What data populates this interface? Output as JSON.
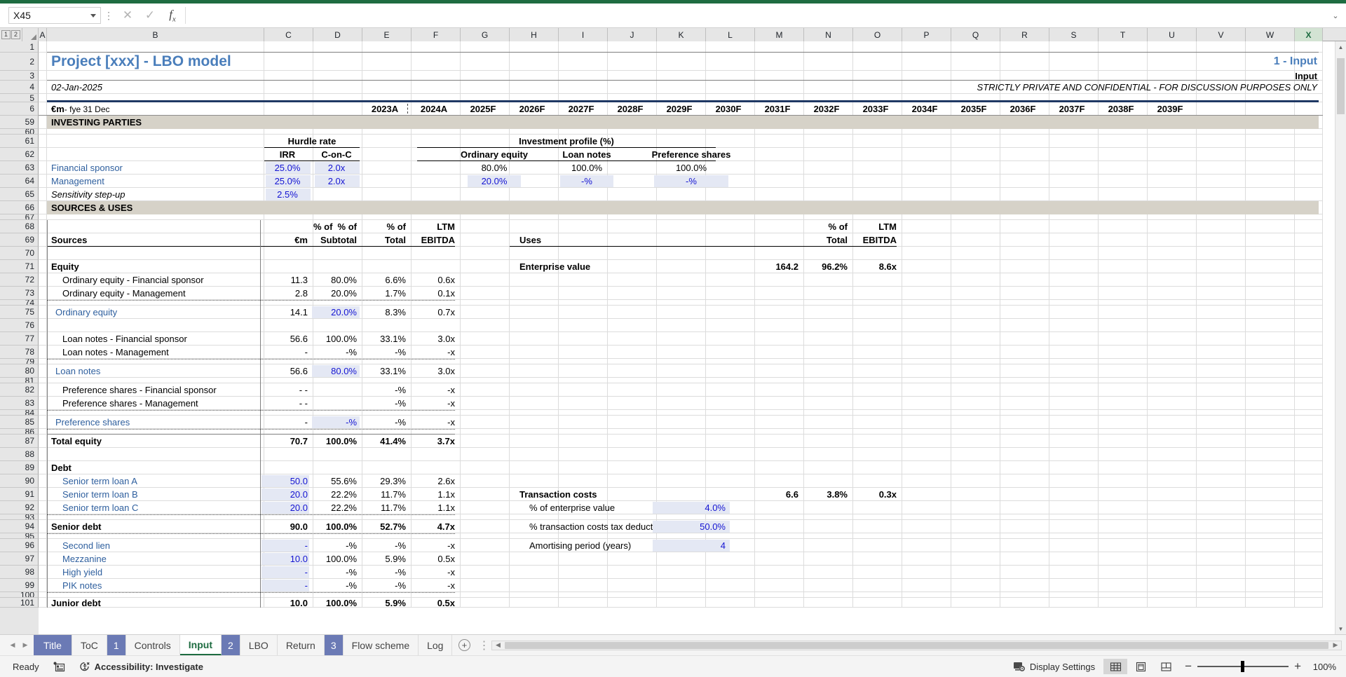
{
  "app": {
    "namebox_value": "X45",
    "formula_value": "",
    "formula_placeholder": ""
  },
  "columns": [
    "A",
    "B",
    "C",
    "D",
    "E",
    "F",
    "G",
    "H",
    "I",
    "J",
    "K",
    "L",
    "M",
    "N",
    "O",
    "P",
    "Q",
    "R",
    "S",
    "T",
    "U",
    "V",
    "W",
    "X"
  ],
  "selected_column": "X",
  "outline_levels": [
    "1",
    "2"
  ],
  "rows": [
    "1",
    "2",
    "3",
    "4",
    "5",
    "6",
    "59",
    "60",
    "61",
    "62",
    "63",
    "64",
    "65",
    "66",
    "67",
    "68",
    "69",
    "70",
    "71",
    "72",
    "73",
    "74",
    "75",
    "76",
    "77",
    "78",
    "79",
    "80",
    "81",
    "82",
    "83",
    "84",
    "85",
    "86",
    "87",
    "88",
    "89",
    "90",
    "91",
    "92",
    "93",
    "94",
    "95",
    "96",
    "97",
    "98",
    "99",
    "100",
    "101"
  ],
  "header": {
    "title": "Project [xxx]  - LBO model",
    "date": "02-Jan-2025",
    "sheet_code": "1 - Input",
    "sheet_name": "Input",
    "confidential": "STRICTLY PRIVATE AND CONFIDENTIAL - FOR DISCUSSION PURPOSES ONLY",
    "units": "€m",
    "units_suffix": " - fye 31 Dec",
    "years": [
      "2023A",
      "2024A",
      "2025F",
      "2026F",
      "2027F",
      "2028F",
      "2029F",
      "2030F",
      "2031F",
      "2032F",
      "2033F",
      "2034F",
      "2035F",
      "2036F",
      "2037F",
      "2038F",
      "2039F"
    ]
  },
  "investing_parties": {
    "section_title": "INVESTING PARTIES",
    "group_headers": {
      "hurdle_rate": "Hurdle rate",
      "investment_profile": "Investment profile (%)"
    },
    "col_headers": {
      "irr": "IRR",
      "conc": "C-on-C",
      "ordinary_equity": "Ordinary equity",
      "loan_notes": "Loan notes",
      "preference_shares": "Preference shares"
    },
    "rows": [
      {
        "label": "Financial sponsor",
        "irr": "25.0%",
        "conc": "2.0x",
        "ordinary_equity": "80.0%",
        "loan_notes": "100.0%",
        "preference_shares": "100.0%"
      },
      {
        "label": "Management",
        "irr": "25.0%",
        "conc": "2.0x",
        "ordinary_equity": "20.0%",
        "loan_notes": "-%",
        "preference_shares": "-%"
      }
    ],
    "sensitivity": {
      "label": "Sensitivity step-up",
      "value": "2.5%"
    }
  },
  "sources_uses": {
    "section_title": "SOURCES & USES",
    "sources": {
      "header": "Sources",
      "col_headers": {
        "amount": "€m",
        "pct_subtotal_l1": "% of",
        "pct_subtotal_l2": "Subtotal",
        "pct_total_l1": "% of",
        "pct_total_l2": "Total",
        "ltm_l1": "LTM",
        "ltm_l2": "EBITDA"
      },
      "rows": [
        {
          "row": 71,
          "label": "Equity",
          "style": "bold",
          "amount": "",
          "pct_subtotal": "",
          "pct_total": "",
          "ltm": ""
        },
        {
          "row": 72,
          "label": "Ordinary equity - Financial sponsor",
          "style": "indent",
          "amount": "11.3",
          "pct_subtotal": "80.0%",
          "pct_total": "6.6%",
          "ltm": "0.6x"
        },
        {
          "row": 73,
          "label": "Ordinary equity - Management",
          "style": "indent",
          "amount": "2.8",
          "pct_subtotal": "20.0%",
          "pct_total": "1.7%",
          "ltm": "0.1x"
        },
        {
          "row": 75,
          "label": "Ordinary equity",
          "style": "subtotal-blue",
          "amount": "14.1",
          "pct_subtotal": "20.0%",
          "pct_subtotal_input": true,
          "pct_total": "8.3%",
          "ltm": "0.7x"
        },
        {
          "row": 77,
          "label": "Loan notes - Financial sponsor",
          "style": "indent",
          "amount": "56.6",
          "pct_subtotal": "100.0%",
          "pct_total": "33.1%",
          "ltm": "3.0x"
        },
        {
          "row": 78,
          "label": "Loan notes - Management",
          "style": "indent",
          "amount": "-",
          "pct_subtotal": "-%",
          "pct_total": "-%",
          "ltm": "-x"
        },
        {
          "row": 80,
          "label": "Loan notes",
          "style": "subtotal-blue",
          "amount": "56.6",
          "pct_subtotal": "80.0%",
          "pct_subtotal_input": true,
          "pct_total": "33.1%",
          "ltm": "3.0x"
        },
        {
          "row": 82,
          "label": "Preference shares - Financial sponsor",
          "style": "indent",
          "amount": "- -",
          "pct_subtotal": "",
          "pct_total": "-%",
          "ltm": "-x"
        },
        {
          "row": 83,
          "label": "Preference shares - Management",
          "style": "indent",
          "amount": "- -",
          "pct_subtotal": "",
          "pct_total": "-%",
          "ltm": "-x"
        },
        {
          "row": 85,
          "label": "Preference shares",
          "style": "subtotal-blue",
          "amount": "-",
          "pct_subtotal": "-%",
          "pct_subtotal_input": true,
          "pct_total": "-%",
          "ltm": "-x"
        },
        {
          "row": 87,
          "label": "Total equity",
          "style": "total",
          "amount": "70.7",
          "pct_subtotal": "100.0%",
          "pct_total": "41.4%",
          "ltm": "3.7x"
        },
        {
          "row": 89,
          "label": "Debt",
          "style": "bold",
          "amount": "",
          "pct_subtotal": "",
          "pct_total": "",
          "ltm": ""
        },
        {
          "row": 90,
          "label": "Senior term loan A",
          "style": "indent-blue",
          "amount": "50.0",
          "amount_input": true,
          "pct_subtotal": "55.6%",
          "pct_total": "29.3%",
          "ltm": "2.6x"
        },
        {
          "row": 91,
          "label": "Senior term loan B",
          "style": "indent-blue",
          "amount": "20.0",
          "amount_input": true,
          "pct_subtotal": "22.2%",
          "pct_total": "11.7%",
          "ltm": "1.1x"
        },
        {
          "row": 92,
          "label": "Senior term loan C",
          "style": "indent-blue",
          "amount": "20.0",
          "amount_input": true,
          "pct_subtotal": "22.2%",
          "pct_total": "11.7%",
          "ltm": "1.1x"
        },
        {
          "row": 94,
          "label": "Senior debt",
          "style": "total",
          "amount": "90.0",
          "pct_subtotal": "100.0%",
          "pct_total": "52.7%",
          "ltm": "4.7x"
        },
        {
          "row": 96,
          "label": "Second lien",
          "style": "indent-blue",
          "amount": "-",
          "amount_input": true,
          "pct_subtotal": "-%",
          "pct_total": "-%",
          "ltm": "-x"
        },
        {
          "row": 97,
          "label": "Mezzanine",
          "style": "indent-blue",
          "amount": "10.0",
          "amount_input": true,
          "pct_subtotal": "100.0%",
          "pct_total": "5.9%",
          "ltm": "0.5x"
        },
        {
          "row": 98,
          "label": "High yield",
          "style": "indent-blue",
          "amount": "-",
          "amount_input": true,
          "pct_subtotal": "-%",
          "pct_total": "-%",
          "ltm": "-x"
        },
        {
          "row": 99,
          "label": "PIK notes",
          "style": "indent-blue",
          "amount": "-",
          "amount_input": true,
          "pct_subtotal": "-%",
          "pct_total": "-%",
          "ltm": "-x"
        },
        {
          "row": 101,
          "label": "Junior debt",
          "style": "total",
          "amount": "10.0",
          "pct_subtotal": "100.0%",
          "pct_total": "5.9%",
          "ltm": "0.5x"
        }
      ]
    },
    "uses": {
      "header": "Uses",
      "col_headers": {
        "pct_total_l1": "% of",
        "pct_total_l2": "Total",
        "ltm_l1": "LTM",
        "ltm_l2": "EBITDA"
      },
      "rows": [
        {
          "row": 71,
          "label": "Enterprise value",
          "style": "bold",
          "amount": "164.2",
          "pct_total": "96.2%",
          "ltm": "8.6x"
        },
        {
          "row": 91,
          "label": "Transaction costs",
          "style": "bold",
          "amount": "6.6",
          "pct_total": "3.8%",
          "ltm": "0.3x"
        },
        {
          "row": 92,
          "label": "% of enterprise value",
          "style": "indent",
          "input_value": "4.0%"
        },
        {
          "row": 94,
          "label": "% transaction costs tax deductible",
          "style": "indent",
          "input_value": "50.0%"
        },
        {
          "row": 96,
          "label": "Amortising period (years)",
          "style": "indent",
          "input_value": "4"
        }
      ]
    }
  },
  "sheet_tabs": [
    {
      "label": "Title",
      "type": "color"
    },
    {
      "label": "ToC",
      "type": "normal"
    },
    {
      "label": "1",
      "type": "color"
    },
    {
      "label": "Controls",
      "type": "normal"
    },
    {
      "label": "Input",
      "type": "active"
    },
    {
      "label": "2",
      "type": "color"
    },
    {
      "label": "LBO",
      "type": "normal"
    },
    {
      "label": "Return",
      "type": "normal"
    },
    {
      "label": "3",
      "type": "color"
    },
    {
      "label": "Flow scheme",
      "type": "normal"
    },
    {
      "label": "Log",
      "type": "normal"
    }
  ],
  "status_bar": {
    "state": "Ready",
    "accessibility": "Accessibility: Investigate",
    "display_settings": "Display Settings",
    "zoom": "100%"
  },
  "colors": {
    "accent_green": "#1e6c41",
    "title_blue": "#4a7ebb",
    "input_blue": "#1414d2",
    "label_blue": "#2e5f9e",
    "band_grey": "#d6d2c8",
    "input_bg": "#e4e8f4",
    "navy_rule": "#1f3864",
    "tab_square": "#6b7ab5"
  }
}
